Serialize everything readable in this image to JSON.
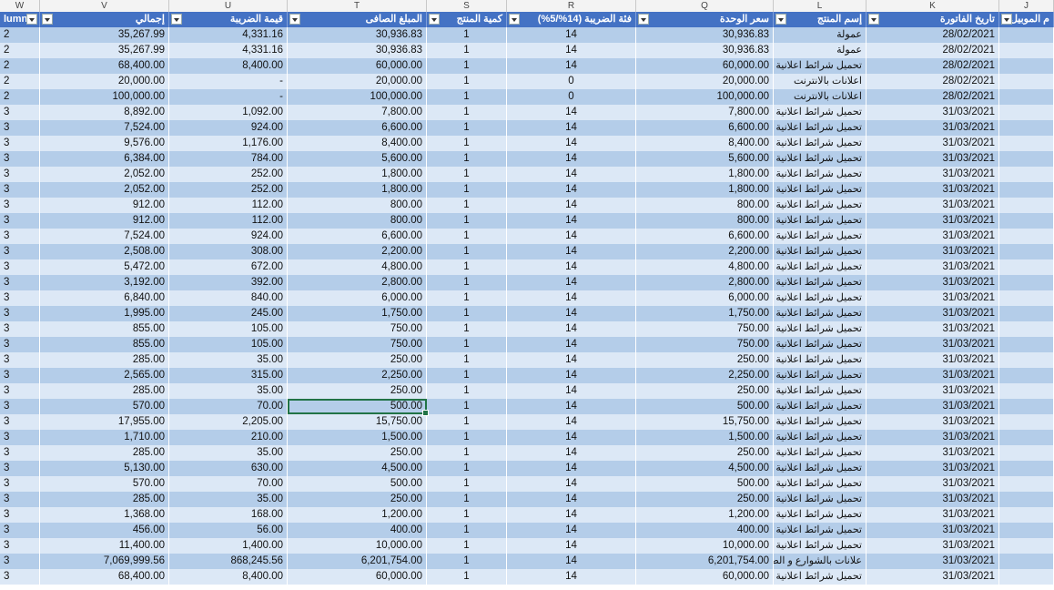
{
  "columns": [
    {
      "letter": "W",
      "header": "lumn1",
      "align": "l"
    },
    {
      "letter": "V",
      "header": "إجمالي",
      "align": "r"
    },
    {
      "letter": "U",
      "header": "قيمة الضريبة",
      "align": "r"
    },
    {
      "letter": "T",
      "header": "المبلغ الصافى",
      "align": "r"
    },
    {
      "letter": "S",
      "header": "كمية المنتج",
      "align": "c"
    },
    {
      "letter": "R",
      "header": "فئة الضريبة (14%/5%)",
      "align": "c"
    },
    {
      "letter": "Q",
      "header": "سعر الوحدة",
      "align": "r"
    },
    {
      "letter": "L",
      "header": "إسم المنتج",
      "align": "ar"
    },
    {
      "letter": "K",
      "header": "تاريخ الفاتورة",
      "align": "r"
    },
    {
      "letter": "J",
      "header": "م الموبيل",
      "align": "r"
    }
  ],
  "rows": [
    [
      "2",
      "35,267.99",
      "4,331.16",
      "30,936.83",
      "1",
      "14",
      "30,936.83",
      "عمولة",
      "28/02/2021",
      ""
    ],
    [
      "2",
      "35,267.99",
      "4,331.16",
      "30,936.83",
      "1",
      "14",
      "30,936.83",
      "عمولة",
      "28/02/2021",
      ""
    ],
    [
      "2",
      "68,400.00",
      "8,400.00",
      "60,000.00",
      "1",
      "14",
      "60,000.00",
      "تحميل شرائط اعلانية",
      "28/02/2021",
      ""
    ],
    [
      "2",
      "20,000.00",
      "-",
      "20,000.00",
      "1",
      "0",
      "20,000.00",
      "اعلانات بالانترنت",
      "28/02/2021",
      ""
    ],
    [
      "2",
      "100,000.00",
      "-",
      "100,000.00",
      "1",
      "0",
      "100,000.00",
      "اعلانات بالانترنت",
      "28/02/2021",
      ""
    ],
    [
      "3",
      "8,892.00",
      "1,092.00",
      "7,800.00",
      "1",
      "14",
      "7,800.00",
      "تحميل شرائط اعلانية",
      "31/03/2021",
      ""
    ],
    [
      "3",
      "7,524.00",
      "924.00",
      "6,600.00",
      "1",
      "14",
      "6,600.00",
      "تحميل شرائط اعلانية",
      "31/03/2021",
      ""
    ],
    [
      "3",
      "9,576.00",
      "1,176.00",
      "8,400.00",
      "1",
      "14",
      "8,400.00",
      "تحميل شرائط اعلانية",
      "31/03/2021",
      ""
    ],
    [
      "3",
      "6,384.00",
      "784.00",
      "5,600.00",
      "1",
      "14",
      "5,600.00",
      "تحميل شرائط اعلانية",
      "31/03/2021",
      ""
    ],
    [
      "3",
      "2,052.00",
      "252.00",
      "1,800.00",
      "1",
      "14",
      "1,800.00",
      "تحميل شرائط اعلانية",
      "31/03/2021",
      ""
    ],
    [
      "3",
      "2,052.00",
      "252.00",
      "1,800.00",
      "1",
      "14",
      "1,800.00",
      "تحميل شرائط اعلانية",
      "31/03/2021",
      ""
    ],
    [
      "3",
      "912.00",
      "112.00",
      "800.00",
      "1",
      "14",
      "800.00",
      "تحميل شرائط اعلانية",
      "31/03/2021",
      ""
    ],
    [
      "3",
      "912.00",
      "112.00",
      "800.00",
      "1",
      "14",
      "800.00",
      "تحميل شرائط اعلانية",
      "31/03/2021",
      ""
    ],
    [
      "3",
      "7,524.00",
      "924.00",
      "6,600.00",
      "1",
      "14",
      "6,600.00",
      "تحميل شرائط اعلانية",
      "31/03/2021",
      ""
    ],
    [
      "3",
      "2,508.00",
      "308.00",
      "2,200.00",
      "1",
      "14",
      "2,200.00",
      "تحميل شرائط اعلانية",
      "31/03/2021",
      ""
    ],
    [
      "3",
      "5,472.00",
      "672.00",
      "4,800.00",
      "1",
      "14",
      "4,800.00",
      "تحميل شرائط اعلانية",
      "31/03/2021",
      ""
    ],
    [
      "3",
      "3,192.00",
      "392.00",
      "2,800.00",
      "1",
      "14",
      "2,800.00",
      "تحميل شرائط اعلانية",
      "31/03/2021",
      ""
    ],
    [
      "3",
      "6,840.00",
      "840.00",
      "6,000.00",
      "1",
      "14",
      "6,000.00",
      "تحميل شرائط اعلانية",
      "31/03/2021",
      ""
    ],
    [
      "3",
      "1,995.00",
      "245.00",
      "1,750.00",
      "1",
      "14",
      "1,750.00",
      "تحميل شرائط اعلانية",
      "31/03/2021",
      ""
    ],
    [
      "3",
      "855.00",
      "105.00",
      "750.00",
      "1",
      "14",
      "750.00",
      "تحميل شرائط اعلانية",
      "31/03/2021",
      ""
    ],
    [
      "3",
      "855.00",
      "105.00",
      "750.00",
      "1",
      "14",
      "750.00",
      "تحميل شرائط اعلانية",
      "31/03/2021",
      ""
    ],
    [
      "3",
      "285.00",
      "35.00",
      "250.00",
      "1",
      "14",
      "250.00",
      "تحميل شرائط اعلانية",
      "31/03/2021",
      ""
    ],
    [
      "3",
      "2,565.00",
      "315.00",
      "2,250.00",
      "1",
      "14",
      "2,250.00",
      "تحميل شرائط اعلانية",
      "31/03/2021",
      ""
    ],
    [
      "3",
      "285.00",
      "35.00",
      "250.00",
      "1",
      "14",
      "250.00",
      "تحميل شرائط اعلانية",
      "31/03/2021",
      ""
    ],
    [
      "3",
      "570.00",
      "70.00",
      "500.00",
      "1",
      "14",
      "500.00",
      "تحميل شرائط اعلانية",
      "31/03/2021",
      ""
    ],
    [
      "3",
      "17,955.00",
      "2,205.00",
      "15,750.00",
      "1",
      "14",
      "15,750.00",
      "تحميل شرائط اعلانية",
      "31/03/2021",
      ""
    ],
    [
      "3",
      "1,710.00",
      "210.00",
      "1,500.00",
      "1",
      "14",
      "1,500.00",
      "تحميل شرائط اعلانية",
      "31/03/2021",
      ""
    ],
    [
      "3",
      "285.00",
      "35.00",
      "250.00",
      "1",
      "14",
      "250.00",
      "تحميل شرائط اعلانية",
      "31/03/2021",
      ""
    ],
    [
      "3",
      "5,130.00",
      "630.00",
      "4,500.00",
      "1",
      "14",
      "4,500.00",
      "تحميل شرائط اعلانية",
      "31/03/2021",
      ""
    ],
    [
      "3",
      "570.00",
      "70.00",
      "500.00",
      "1",
      "14",
      "500.00",
      "تحميل شرائط اعلانية",
      "31/03/2021",
      ""
    ],
    [
      "3",
      "285.00",
      "35.00",
      "250.00",
      "1",
      "14",
      "250.00",
      "تحميل شرائط اعلانية",
      "31/03/2021",
      ""
    ],
    [
      "3",
      "1,368.00",
      "168.00",
      "1,200.00",
      "1",
      "14",
      "1,200.00",
      "تحميل شرائط اعلانية",
      "31/03/2021",
      ""
    ],
    [
      "3",
      "456.00",
      "56.00",
      "400.00",
      "1",
      "14",
      "400.00",
      "تحميل شرائط اعلانية",
      "31/03/2021",
      ""
    ],
    [
      "3",
      "11,400.00",
      "1,400.00",
      "10,000.00",
      "1",
      "14",
      "10,000.00",
      "تحميل شرائط اعلانية",
      "31/03/2021",
      ""
    ],
    [
      "3",
      "7,069,999.56",
      "868,245.56",
      "6,201,754.00",
      "1",
      "14",
      "6,201,754.00",
      "علانات بالشوارع و الطرق",
      "31/03/2021",
      ""
    ],
    [
      "3",
      "68,400.00",
      "8,400.00",
      "60,000.00",
      "1",
      "14",
      "60,000.00",
      "تحميل شرائط اعلانية",
      "31/03/2021",
      ""
    ]
  ],
  "selected_cell": {
    "row": 24,
    "col": 3
  }
}
